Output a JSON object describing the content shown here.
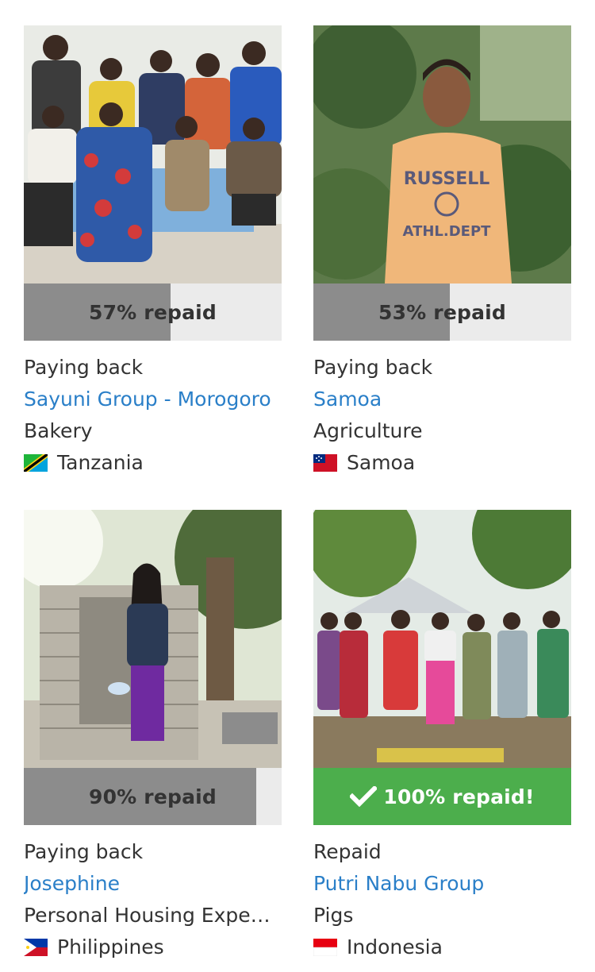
{
  "loans": [
    {
      "status": "Paying back",
      "name": "Sayuni Group - Morogoro",
      "sector": "Bakery",
      "country": "Tanzania",
      "flag_icon": "tanzania-flag-icon",
      "progress_label": "57% repaid",
      "percent_repaid": 57,
      "fully_repaid": false
    },
    {
      "status": "Paying back",
      "name": "Samoa",
      "sector": "Agriculture",
      "country": "Samoa",
      "flag_icon": "samoa-flag-icon",
      "progress_label": "53% repaid",
      "percent_repaid": 53,
      "fully_repaid": false
    },
    {
      "status": "Paying back",
      "name": "Josephine",
      "sector": "Personal Housing Expen...",
      "country": "Philippines",
      "flag_icon": "philippines-flag-icon",
      "progress_label": "90% repaid",
      "percent_repaid": 90,
      "fully_repaid": false
    },
    {
      "status": "Repaid",
      "name": "Putri Nabu Group",
      "sector": "Pigs",
      "country": "Indonesia",
      "flag_icon": "indonesia-flag-icon",
      "progress_label": "100% repaid!",
      "percent_repaid": 100,
      "fully_repaid": true,
      "check_icon": "checkmark-icon"
    }
  ],
  "colors": {
    "link": "#2a7fc8",
    "progress_fill": "#8c8c8c",
    "progress_track": "#ebebeb",
    "repaid_green": "#4cae4c",
    "text": "#333333"
  }
}
